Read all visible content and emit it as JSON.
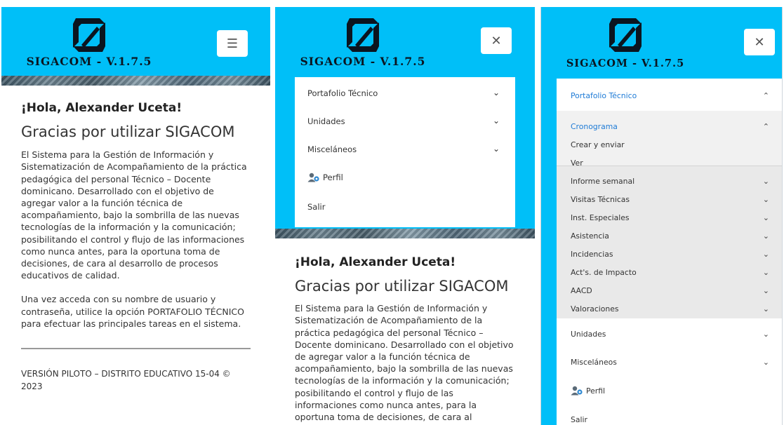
{
  "brand": {
    "logo_text": "SIGACOM - V.1.7.5"
  },
  "icons": {
    "menu_toggle": "☰",
    "close_toggle": "✕",
    "chevron_down": "⌄",
    "chevron_up": "⌃"
  },
  "welcome": {
    "greeting": "¡Hola, Alexander Uceta!",
    "thanks": "Gracias por utilizar SIGACOM",
    "description": "El Sistema para la Gestión de Información y Sistematización de Acompañamiento de la práctica pedagógica del personal Técnico – Docente dominicano. Desarrollado con el objetivo de agregar valor a la función técnica de acompañamiento, bajo la sombrilla de las nuevas tecnologías de la información y la comunicación; posibilitando el control y flujo de las informaciones como nunca antes, para la oportuna toma de decisiones, de cara al desarrollo de procesos educativos de calidad.",
    "instructions": "Una vez acceda con su nombre de usuario y contraseña, utilice la opción PORTAFOLIO TÉCNICO para efectuar las principales tareas en el sistema.",
    "footer": "VERSIÓN PILOTO – DISTRITO EDUCATIVO 15-04 © 2023"
  },
  "nav": {
    "portafolio": "Portafolio Técnico",
    "unidades": "Unidades",
    "miscelaneos": "Misceláneos",
    "perfil": "Perfil",
    "salir": "Salir"
  },
  "submenu": {
    "cronograma": "Cronograma",
    "crear": "Crear y enviar",
    "ver": "Ver",
    "items": [
      "Informe semanal",
      "Visitas Técnicas",
      "Inst. Especiales",
      "Asistencia",
      "Incidencias",
      "Act's. de Impacto",
      "AACD",
      "Valoraciones"
    ]
  },
  "colors": {
    "header_bg": "#00bff8",
    "link_blue": "#1e7bd6",
    "submenu_bg": "#e9e9e9"
  }
}
